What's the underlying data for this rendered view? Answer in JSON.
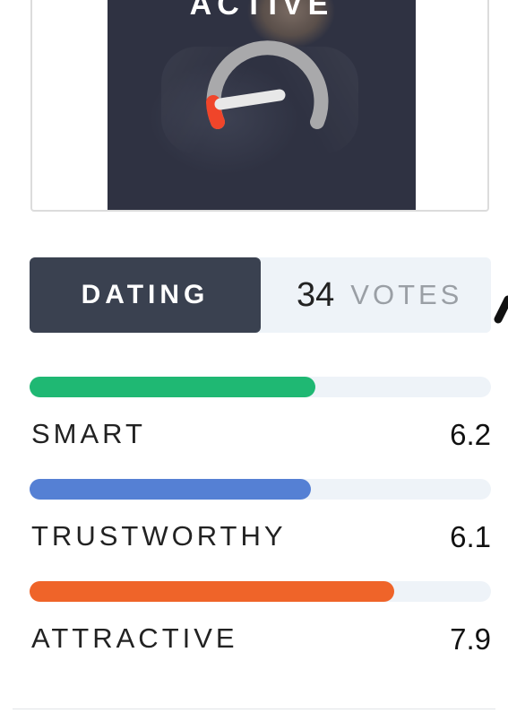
{
  "photo": {
    "status_label": "ACTIVE",
    "gauge_icon": "speedometer-gauge-icon"
  },
  "category": {
    "tab_label": "DATING",
    "votes_count": "34",
    "votes_label": "VOTES"
  },
  "ratings": [
    {
      "label": "SMART",
      "value": "6.2",
      "level": 0.62,
      "color": "#1fb873"
    },
    {
      "label": "TRUSTWORTHY",
      "value": "6.1",
      "level": 0.61,
      "color": "#5580d4"
    },
    {
      "label": "ATTRACTIVE",
      "value": "7.9",
      "level": 0.79,
      "color": "#ef6429"
    }
  ]
}
